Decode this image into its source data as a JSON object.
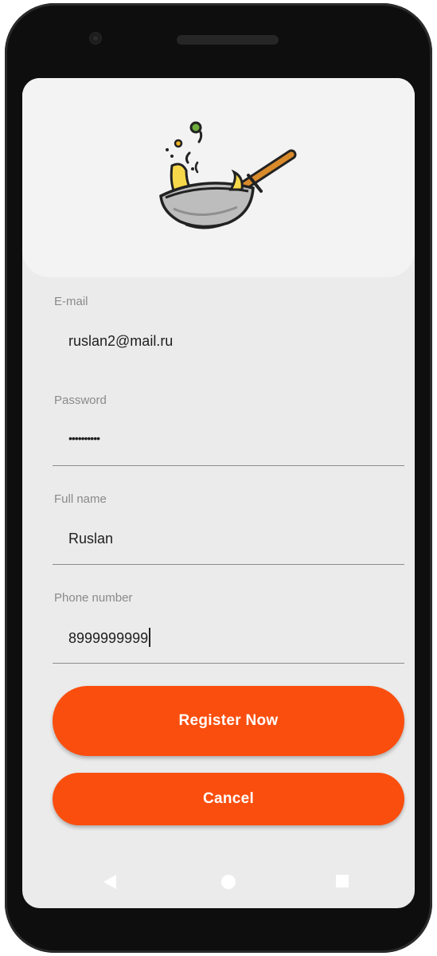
{
  "form": {
    "email": {
      "label": "E-mail",
      "value": "ruslan2@mail.ru"
    },
    "password": {
      "label": "Password",
      "value": "••••••••••"
    },
    "full_name": {
      "label": "Full name",
      "value": "Ruslan"
    },
    "phone": {
      "label": "Phone number",
      "value": "8999999999"
    }
  },
  "buttons": {
    "register": "Register Now",
    "cancel": "Cancel"
  },
  "colors": {
    "accent": "#fa4e0e",
    "background": "#ebebeb",
    "header": "#f3f3f3"
  },
  "icons": {
    "logo": "wok-pan-icon",
    "nav_back": "back-triangle-icon",
    "nav_home": "home-circle-icon",
    "nav_recent": "recent-apps-square-icon"
  }
}
